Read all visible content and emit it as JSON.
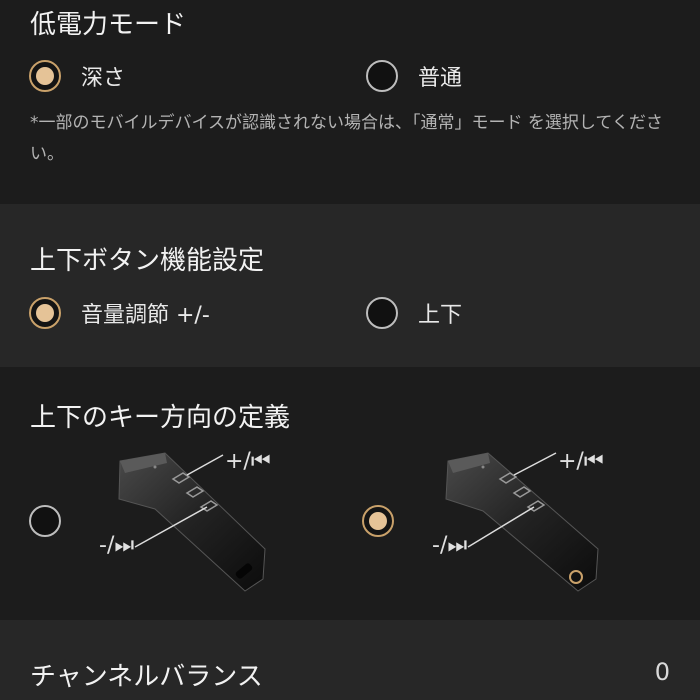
{
  "low_power_mode": {
    "title": "低電力モード",
    "options": [
      {
        "label": "深さ",
        "selected": true
      },
      {
        "label": "普通",
        "selected": false
      }
    ],
    "note": "*一部のモバイルデバイスが認識されない場合は、「通常」モード を選択してください。"
  },
  "updown_button": {
    "title": "上下ボタン機能設定",
    "options": [
      {
        "label": "音量調節 +/-",
        "selected": true
      },
      {
        "label": "上下",
        "selected": false
      }
    ]
  },
  "key_direction": {
    "title": "上下のキー方向の定義",
    "options": [
      {
        "plus_label": "+/⏮",
        "minus_label": "-/⏭",
        "selected": false
      },
      {
        "plus_label": "+/⏮",
        "minus_label": "-/⏭",
        "selected": true
      }
    ]
  },
  "channel_balance": {
    "title": "チャンネルバランス",
    "value": "0"
  },
  "colors": {
    "background": "#1c1c1c",
    "section_alt": "#272727",
    "accent": "#e5c397"
  }
}
